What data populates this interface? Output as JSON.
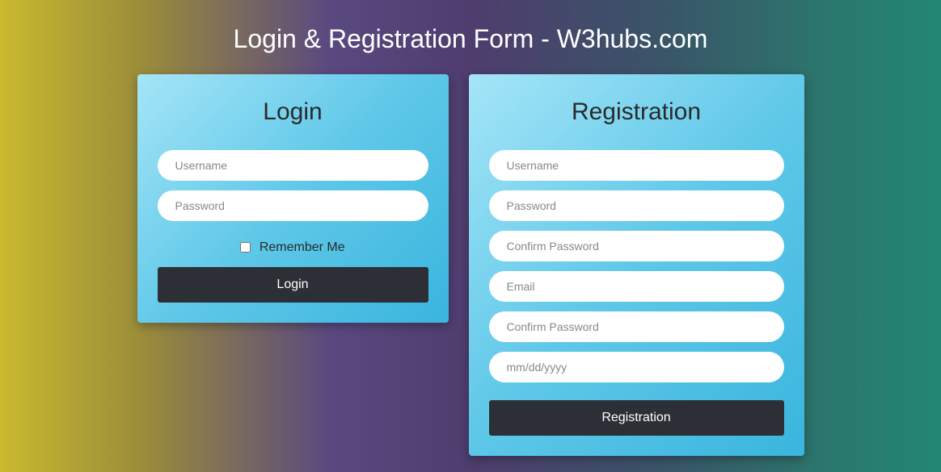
{
  "page": {
    "title": "Login & Registration Form - W3hubs.com"
  },
  "login": {
    "title": "Login",
    "username_placeholder": "Username",
    "password_placeholder": "Password",
    "remember_label": "Remember Me",
    "submit_label": "Login"
  },
  "registration": {
    "title": "Registration",
    "username_placeholder": "Username",
    "password_placeholder": "Password",
    "confirm_password_placeholder": "Confirm Password",
    "email_placeholder": "Email",
    "confirm_password2_placeholder": "Confirm Password",
    "date_placeholder": "mm/dd/yyyy",
    "submit_label": "Registration"
  }
}
